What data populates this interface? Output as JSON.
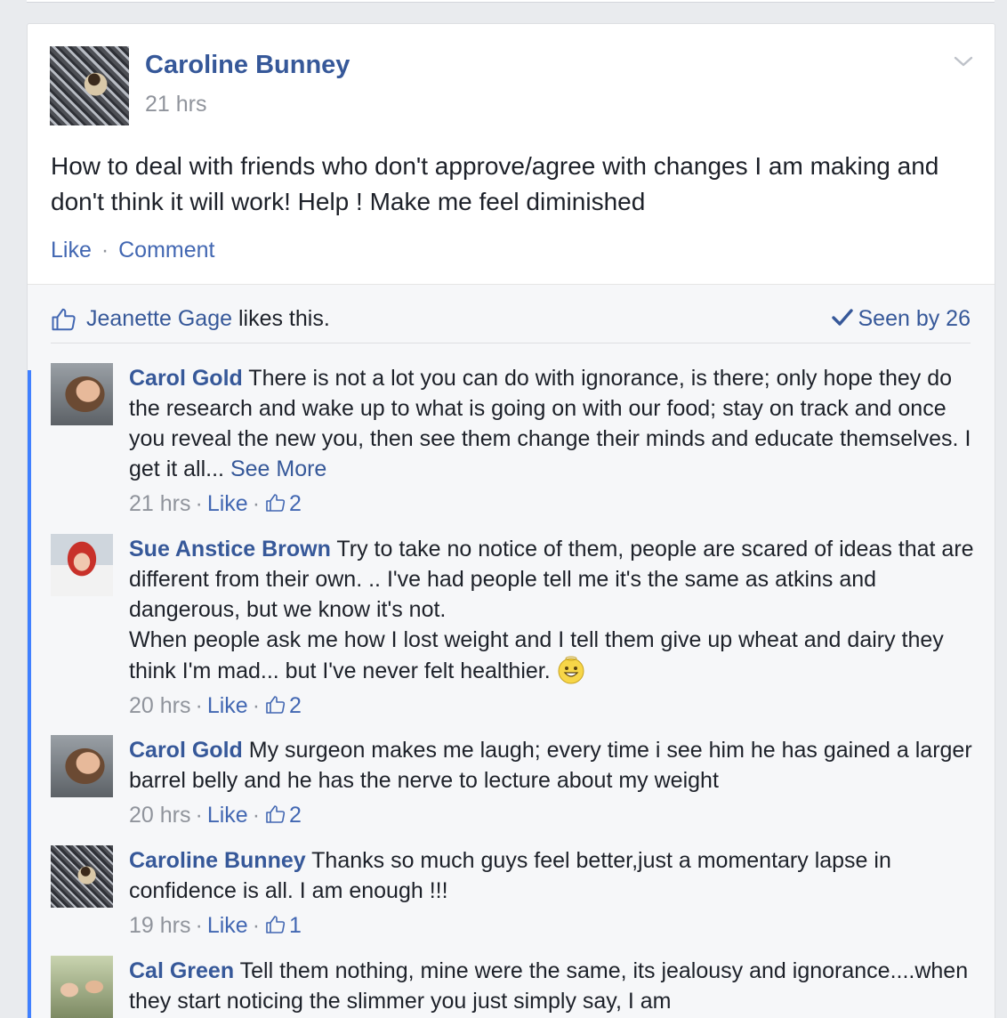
{
  "post": {
    "author": "Caroline Bunney",
    "time": "21 hrs",
    "text": "How to deal with friends who don't approve/agree with changes I am making and don't think it will work! Help ! Make me feel diminished",
    "like_label": "Like",
    "comment_label": "Comment",
    "separator": "·"
  },
  "likes": {
    "name": "Jeanette Gage",
    "suffix": " likes this.",
    "seen_label": "Seen by 26"
  },
  "comments": [
    {
      "author": "Carol Gold",
      "text": "There is not a lot you can do with ignorance, is there; only hope they do the research and wake up to what is going on with our food; stay on track and once you reveal the new you, then see them change their minds and educate themselves. I get it all...",
      "more": "See More",
      "time": "21 hrs",
      "like": "Like",
      "count": "2"
    },
    {
      "author": "Sue Anstice Brown",
      "text": "Try to take no notice of them, people are scared of ideas that are different from their own. .. I've had people tell me it's the same as atkins and dangerous, but we know it's not.",
      "text2": "When people ask me how I lost weight and I tell them give up wheat and dairy they think I'm mad... but I've never felt healthier.",
      "time": "20 hrs",
      "like": "Like",
      "count": "2"
    },
    {
      "author": "Carol Gold",
      "text": "My surgeon makes me laugh; every time i see him he has gained a larger barrel belly and he has the nerve to lecture about my weight",
      "time": "20 hrs",
      "like": "Like",
      "count": "2"
    },
    {
      "author": "Caroline Bunney",
      "text": "Thanks so much guys feel better,just a momentary lapse in confidence is all. I am enough !!!",
      "time": "19 hrs",
      "like": "Like",
      "count": "1"
    },
    {
      "author": "Cal Green",
      "text": "Tell them nothing, mine were the same, its jealousy and ignorance....when they start noticing the slimmer you just simply say, I am"
    }
  ],
  "icons": {
    "options": "chevron-down-icon",
    "like": "thumbs-up-icon",
    "seen": "checkmark-icon",
    "emoji": "grinning-face-icon"
  },
  "colors": {
    "link": "#365899",
    "action": "#4267b2",
    "muted": "#90949c",
    "reply_bar": "#4080ff"
  }
}
